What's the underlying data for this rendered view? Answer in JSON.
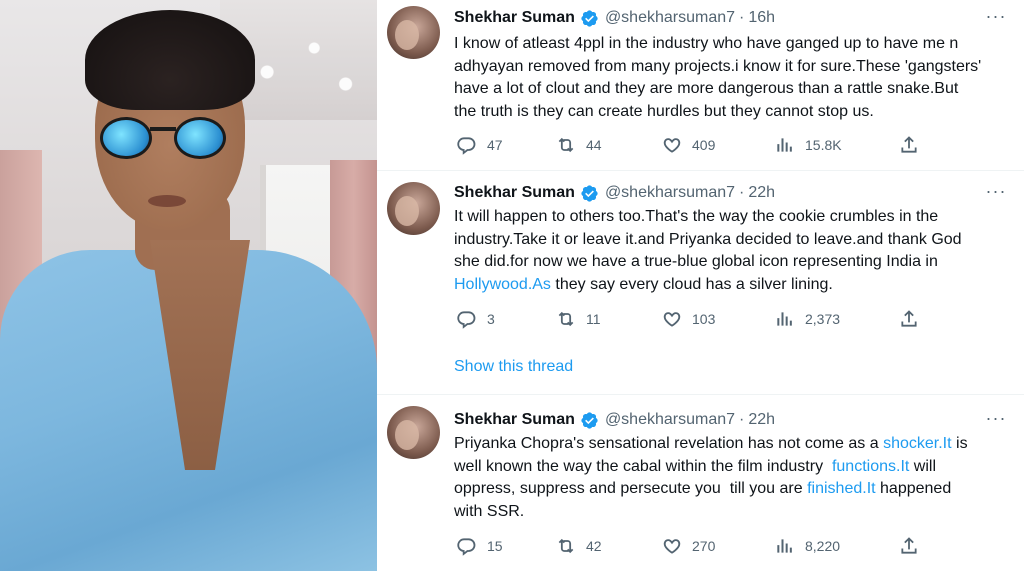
{
  "tweets": [
    {
      "name": "Shekhar Suman",
      "handle": "@shekharsuman7",
      "separator": "·",
      "time": "16h",
      "more": "···",
      "text_parts": [
        {
          "t": "I know of atleast 4ppl in the industry who have ganged up to have me n\nadhyayan removed from many projects.i know it for sure.These 'gangsters'\nhave a lot of clout and they are more dangerous than a rattle snake.But\nthe truth is they can create hurdles but they cannot stop us.",
          "link": false
        }
      ],
      "replies": "47",
      "retweets": "44",
      "likes": "409",
      "views": "15.8K"
    },
    {
      "name": "Shekhar Suman",
      "handle": "@shekharsuman7",
      "separator": "·",
      "time": "22h",
      "more": "···",
      "text_parts": [
        {
          "t": "It will happen to others too.That's the way the cookie crumbles in the\nindustry.Take it or leave it.and Priyanka decided to leave.and thank God\nshe did.for now we have a true-blue global icon representing India in\n",
          "link": false
        },
        {
          "t": "Hollywood.As",
          "link": true
        },
        {
          "t": " they say every cloud has a silver lining.",
          "link": false
        }
      ],
      "replies": "3",
      "retweets": "11",
      "likes": "103",
      "views": "2,373"
    },
    {
      "name": "Shekhar Suman",
      "handle": "@shekharsuman7",
      "separator": "·",
      "time": "22h",
      "more": "···",
      "text_parts": [
        {
          "t": "Priyanka Chopra's sensational revelation has not come as a ",
          "link": false
        },
        {
          "t": "shocker.It",
          "link": true
        },
        {
          "t": " is\nwell known the way the cabal within the film industry  ",
          "link": false
        },
        {
          "t": "functions.It",
          "link": true
        },
        {
          "t": " will\noppress, suppress and persecute you  till you are ",
          "link": false
        },
        {
          "t": "finished.It",
          "link": true
        },
        {
          "t": " happened\nwith SSR.",
          "link": false
        }
      ],
      "replies": "15",
      "retweets": "42",
      "likes": "270",
      "views": "8,220"
    }
  ],
  "show_thread": "Show this thread",
  "colors": {
    "link": "#1d9bf0",
    "verified": "#1d9bf0",
    "secondary_text": "#536471",
    "divider": "#eff3f4"
  },
  "icons": [
    "verified-badge-icon",
    "reply-icon",
    "retweet-icon",
    "like-icon",
    "views-icon",
    "share-icon",
    "more-icon"
  ]
}
